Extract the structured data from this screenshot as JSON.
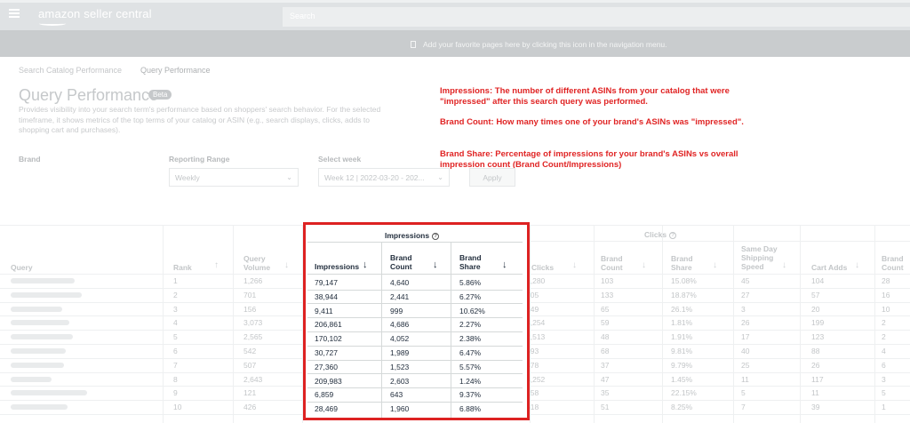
{
  "header": {
    "logo": "amazon seller central",
    "search_placeholder": "Search",
    "favorites_hint": "Add your favorite pages here by clicking this icon in the navigation menu."
  },
  "breadcrumb": {
    "item1": "Search Catalog Performance",
    "item2": "Query Performance"
  },
  "page": {
    "title": "Query Performance",
    "badge": "Beta",
    "description": "Provides visibility into your search term's performance based on shoppers' search behavior. For the selected timeframe, it shows metrics of the top terms of your catalog or ASIN (e.g., search displays, clicks, adds to shopping cart and purchases)."
  },
  "annotations": {
    "impressions": "Impressions: The number of different ASINs from your catalog that were \"impressed\" after this search query was performed.",
    "brand_count": "Brand Count: How many times one of your brand's ASINs was \"impressed\".",
    "brand_share": "Brand Share: Percentage of impressions for your brand's ASINs vs overall impression count (Brand Count/Impressions)"
  },
  "filters": {
    "brand_label": "Brand",
    "range_label": "Reporting Range",
    "range_value": "Weekly",
    "week_label": "Select week",
    "week_value": "Week 12 | 2022-03-20 - 202...",
    "apply": "Apply"
  },
  "table": {
    "headers": {
      "query": "Query",
      "rank": "Rank",
      "query_volume": [
        "Query",
        "Volume"
      ],
      "impressions_group": "Impressions",
      "impressions": "Impressions",
      "brand_count": [
        "Brand",
        "Count"
      ],
      "brand_share": [
        "Brand",
        "Share"
      ],
      "clicks_group": "Clicks",
      "clicks": "Clicks",
      "clicks_brand_count": [
        "Brand",
        "Count"
      ],
      "clicks_brand_share": [
        "Brand",
        "Share"
      ],
      "same_day": [
        "Same Day",
        "Shipping",
        "Speed"
      ],
      "cart_adds": "Cart Adds",
      "cart_brand_count": [
        "Brand",
        "Count"
      ]
    },
    "rows": [
      {
        "rank": "1",
        "volume": "1,266",
        "impressions": "79,147",
        "brand_count": "4,640",
        "brand_share": "5.86%",
        "clicks": "1,280",
        "c_count": "103",
        "c_share": "15.08%",
        "same_day": "45",
        "cart": "104",
        "cart_count": "28"
      },
      {
        "rank": "2",
        "volume": "701",
        "impressions": "38,944",
        "brand_count": "2,441",
        "brand_share": "6.27%",
        "clicks": "705",
        "c_count": "133",
        "c_share": "18.87%",
        "same_day": "27",
        "cart": "57",
        "cart_count": "16"
      },
      {
        "rank": "3",
        "volume": "156",
        "impressions": "9,411",
        "brand_count": "999",
        "brand_share": "10.62%",
        "clicks": "249",
        "c_count": "65",
        "c_share": "26.1%",
        "same_day": "3",
        "cart": "20",
        "cart_count": "10"
      },
      {
        "rank": "4",
        "volume": "3,073",
        "impressions": "206,861",
        "brand_count": "4,686",
        "brand_share": "2.27%",
        "clicks": "3,254",
        "c_count": "59",
        "c_share": "1.81%",
        "same_day": "26",
        "cart": "199",
        "cart_count": "2"
      },
      {
        "rank": "5",
        "volume": "2,565",
        "impressions": "170,102",
        "brand_count": "4,052",
        "brand_share": "2.38%",
        "clicks": "2,513",
        "c_count": "48",
        "c_share": "1.91%",
        "same_day": "17",
        "cart": "123",
        "cart_count": "2"
      },
      {
        "rank": "6",
        "volume": "542",
        "impressions": "30,727",
        "brand_count": "1,989",
        "brand_share": "6.47%",
        "clicks": "693",
        "c_count": "68",
        "c_share": "9.81%",
        "same_day": "40",
        "cart": "88",
        "cart_count": "4"
      },
      {
        "rank": "7",
        "volume": "507",
        "impressions": "27,360",
        "brand_count": "1,523",
        "brand_share": "5.57%",
        "clicks": "378",
        "c_count": "37",
        "c_share": "9.79%",
        "same_day": "25",
        "cart": "26",
        "cart_count": "6"
      },
      {
        "rank": "8",
        "volume": "2,643",
        "impressions": "209,983",
        "brand_count": "2,603",
        "brand_share": "1.24%",
        "clicks": "3,252",
        "c_count": "47",
        "c_share": "1.45%",
        "same_day": "11",
        "cart": "117",
        "cart_count": "3"
      },
      {
        "rank": "9",
        "volume": "121",
        "impressions": "6,859",
        "brand_count": "643",
        "brand_share": "9.37%",
        "clicks": "158",
        "c_count": "35",
        "c_share": "22.15%",
        "same_day": "5",
        "cart": "11",
        "cart_count": "5"
      },
      {
        "rank": "10",
        "volume": "426",
        "impressions": "28,469",
        "brand_count": "1,960",
        "brand_share": "6.88%",
        "clicks": "618",
        "c_count": "51",
        "c_share": "8.25%",
        "same_day": "7",
        "cart": "39",
        "cart_count": "1"
      }
    ]
  },
  "colors": {
    "annotation": "#e02424",
    "highlight_border": "#dd2222",
    "text_dark": "#232f3e"
  }
}
